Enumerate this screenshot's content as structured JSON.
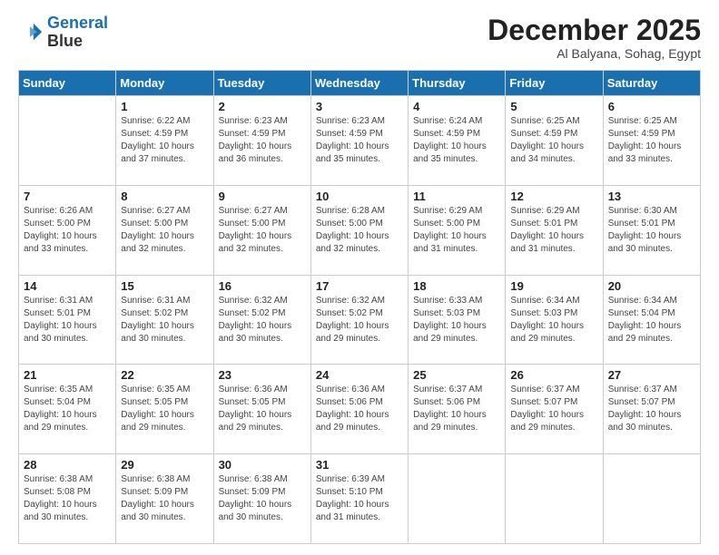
{
  "logo": {
    "line1": "General",
    "line2": "Blue"
  },
  "header": {
    "month": "December 2025",
    "location": "Al Balyana, Sohag, Egypt"
  },
  "weekdays": [
    "Sunday",
    "Monday",
    "Tuesday",
    "Wednesday",
    "Thursday",
    "Friday",
    "Saturday"
  ],
  "weeks": [
    [
      {
        "day": "",
        "sunrise": "",
        "sunset": "",
        "daylight": ""
      },
      {
        "day": "1",
        "sunrise": "Sunrise: 6:22 AM",
        "sunset": "Sunset: 4:59 PM",
        "daylight": "Daylight: 10 hours and 37 minutes."
      },
      {
        "day": "2",
        "sunrise": "Sunrise: 6:23 AM",
        "sunset": "Sunset: 4:59 PM",
        "daylight": "Daylight: 10 hours and 36 minutes."
      },
      {
        "day": "3",
        "sunrise": "Sunrise: 6:23 AM",
        "sunset": "Sunset: 4:59 PM",
        "daylight": "Daylight: 10 hours and 35 minutes."
      },
      {
        "day": "4",
        "sunrise": "Sunrise: 6:24 AM",
        "sunset": "Sunset: 4:59 PM",
        "daylight": "Daylight: 10 hours and 35 minutes."
      },
      {
        "day": "5",
        "sunrise": "Sunrise: 6:25 AM",
        "sunset": "Sunset: 4:59 PM",
        "daylight": "Daylight: 10 hours and 34 minutes."
      },
      {
        "day": "6",
        "sunrise": "Sunrise: 6:25 AM",
        "sunset": "Sunset: 4:59 PM",
        "daylight": "Daylight: 10 hours and 33 minutes."
      }
    ],
    [
      {
        "day": "7",
        "sunrise": "Sunrise: 6:26 AM",
        "sunset": "Sunset: 5:00 PM",
        "daylight": "Daylight: 10 hours and 33 minutes."
      },
      {
        "day": "8",
        "sunrise": "Sunrise: 6:27 AM",
        "sunset": "Sunset: 5:00 PM",
        "daylight": "Daylight: 10 hours and 32 minutes."
      },
      {
        "day": "9",
        "sunrise": "Sunrise: 6:27 AM",
        "sunset": "Sunset: 5:00 PM",
        "daylight": "Daylight: 10 hours and 32 minutes."
      },
      {
        "day": "10",
        "sunrise": "Sunrise: 6:28 AM",
        "sunset": "Sunset: 5:00 PM",
        "daylight": "Daylight: 10 hours and 32 minutes."
      },
      {
        "day": "11",
        "sunrise": "Sunrise: 6:29 AM",
        "sunset": "Sunset: 5:00 PM",
        "daylight": "Daylight: 10 hours and 31 minutes."
      },
      {
        "day": "12",
        "sunrise": "Sunrise: 6:29 AM",
        "sunset": "Sunset: 5:01 PM",
        "daylight": "Daylight: 10 hours and 31 minutes."
      },
      {
        "day": "13",
        "sunrise": "Sunrise: 6:30 AM",
        "sunset": "Sunset: 5:01 PM",
        "daylight": "Daylight: 10 hours and 30 minutes."
      }
    ],
    [
      {
        "day": "14",
        "sunrise": "Sunrise: 6:31 AM",
        "sunset": "Sunset: 5:01 PM",
        "daylight": "Daylight: 10 hours and 30 minutes."
      },
      {
        "day": "15",
        "sunrise": "Sunrise: 6:31 AM",
        "sunset": "Sunset: 5:02 PM",
        "daylight": "Daylight: 10 hours and 30 minutes."
      },
      {
        "day": "16",
        "sunrise": "Sunrise: 6:32 AM",
        "sunset": "Sunset: 5:02 PM",
        "daylight": "Daylight: 10 hours and 30 minutes."
      },
      {
        "day": "17",
        "sunrise": "Sunrise: 6:32 AM",
        "sunset": "Sunset: 5:02 PM",
        "daylight": "Daylight: 10 hours and 29 minutes."
      },
      {
        "day": "18",
        "sunrise": "Sunrise: 6:33 AM",
        "sunset": "Sunset: 5:03 PM",
        "daylight": "Daylight: 10 hours and 29 minutes."
      },
      {
        "day": "19",
        "sunrise": "Sunrise: 6:34 AM",
        "sunset": "Sunset: 5:03 PM",
        "daylight": "Daylight: 10 hours and 29 minutes."
      },
      {
        "day": "20",
        "sunrise": "Sunrise: 6:34 AM",
        "sunset": "Sunset: 5:04 PM",
        "daylight": "Daylight: 10 hours and 29 minutes."
      }
    ],
    [
      {
        "day": "21",
        "sunrise": "Sunrise: 6:35 AM",
        "sunset": "Sunset: 5:04 PM",
        "daylight": "Daylight: 10 hours and 29 minutes."
      },
      {
        "day": "22",
        "sunrise": "Sunrise: 6:35 AM",
        "sunset": "Sunset: 5:05 PM",
        "daylight": "Daylight: 10 hours and 29 minutes."
      },
      {
        "day": "23",
        "sunrise": "Sunrise: 6:36 AM",
        "sunset": "Sunset: 5:05 PM",
        "daylight": "Daylight: 10 hours and 29 minutes."
      },
      {
        "day": "24",
        "sunrise": "Sunrise: 6:36 AM",
        "sunset": "Sunset: 5:06 PM",
        "daylight": "Daylight: 10 hours and 29 minutes."
      },
      {
        "day": "25",
        "sunrise": "Sunrise: 6:37 AM",
        "sunset": "Sunset: 5:06 PM",
        "daylight": "Daylight: 10 hours and 29 minutes."
      },
      {
        "day": "26",
        "sunrise": "Sunrise: 6:37 AM",
        "sunset": "Sunset: 5:07 PM",
        "daylight": "Daylight: 10 hours and 29 minutes."
      },
      {
        "day": "27",
        "sunrise": "Sunrise: 6:37 AM",
        "sunset": "Sunset: 5:07 PM",
        "daylight": "Daylight: 10 hours and 30 minutes."
      }
    ],
    [
      {
        "day": "28",
        "sunrise": "Sunrise: 6:38 AM",
        "sunset": "Sunset: 5:08 PM",
        "daylight": "Daylight: 10 hours and 30 minutes."
      },
      {
        "day": "29",
        "sunrise": "Sunrise: 6:38 AM",
        "sunset": "Sunset: 5:09 PM",
        "daylight": "Daylight: 10 hours and 30 minutes."
      },
      {
        "day": "30",
        "sunrise": "Sunrise: 6:38 AM",
        "sunset": "Sunset: 5:09 PM",
        "daylight": "Daylight: 10 hours and 30 minutes."
      },
      {
        "day": "31",
        "sunrise": "Sunrise: 6:39 AM",
        "sunset": "Sunset: 5:10 PM",
        "daylight": "Daylight: 10 hours and 31 minutes."
      },
      {
        "day": "",
        "sunrise": "",
        "sunset": "",
        "daylight": ""
      },
      {
        "day": "",
        "sunrise": "",
        "sunset": "",
        "daylight": ""
      },
      {
        "day": "",
        "sunrise": "",
        "sunset": "",
        "daylight": ""
      }
    ]
  ]
}
